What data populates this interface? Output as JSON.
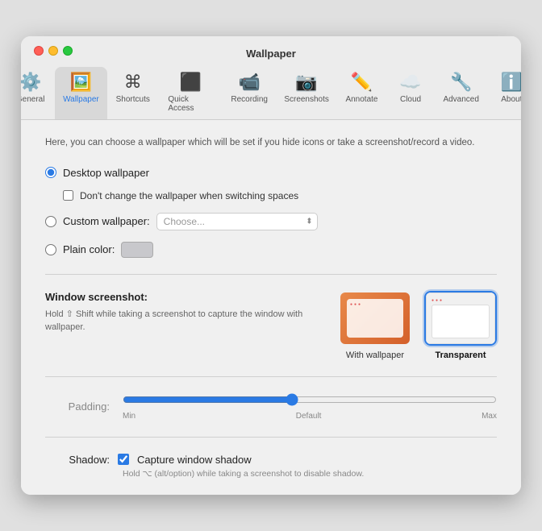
{
  "window": {
    "title": "Wallpaper"
  },
  "toolbar": {
    "items": [
      {
        "id": "general",
        "label": "General",
        "icon": "⚙️",
        "active": false
      },
      {
        "id": "wallpaper",
        "label": "Wallpaper",
        "icon": "🖼️",
        "active": true
      },
      {
        "id": "shortcuts",
        "label": "Shortcuts",
        "icon": "⌘",
        "active": false
      },
      {
        "id": "quick-access",
        "label": "Quick Access",
        "icon": "🔲",
        "active": false
      },
      {
        "id": "recording",
        "label": "Recording",
        "icon": "📹",
        "active": false
      },
      {
        "id": "screenshots",
        "label": "Screenshots",
        "icon": "📷",
        "active": false
      },
      {
        "id": "annotate",
        "label": "Annotate",
        "icon": "✏️",
        "active": false
      },
      {
        "id": "cloud",
        "label": "Cloud",
        "icon": "☁️",
        "active": false
      },
      {
        "id": "advanced",
        "label": "Advanced",
        "icon": "🔧",
        "active": false
      },
      {
        "id": "about",
        "label": "About",
        "icon": "ℹ️",
        "active": false
      }
    ]
  },
  "content": {
    "description": "Here, you can choose a wallpaper which will be set if you hide icons\nor take a screenshot/record a video.",
    "wallpaper_options": {
      "desktop": {
        "label": "Desktop wallpaper",
        "checked": true
      },
      "no_change": {
        "label": "Don't change the wallpaper when switching spaces",
        "checked": false
      },
      "custom": {
        "label": "Custom wallpaper:",
        "checked": false,
        "placeholder": "Choose..."
      },
      "plain_color": {
        "label": "Plain color:",
        "checked": false
      }
    },
    "window_screenshot": {
      "label": "Window screenshot:",
      "description": "Hold ⇧ Shift while taking a screenshot to capture the window with wallpaper.",
      "options": [
        {
          "id": "with-wallpaper",
          "label": "With wallpaper",
          "active": false
        },
        {
          "id": "transparent",
          "label": "Transparent",
          "active": true
        }
      ]
    },
    "padding": {
      "label": "Padding:",
      "min": "Min",
      "default": "Default",
      "max": "Max",
      "value": 45
    },
    "shadow": {
      "label": "Shadow:",
      "checkbox_label": "Capture window shadow",
      "checked": true,
      "hint": "Hold ⌥ (alt/option) while taking a screenshot to disable shadow."
    }
  }
}
